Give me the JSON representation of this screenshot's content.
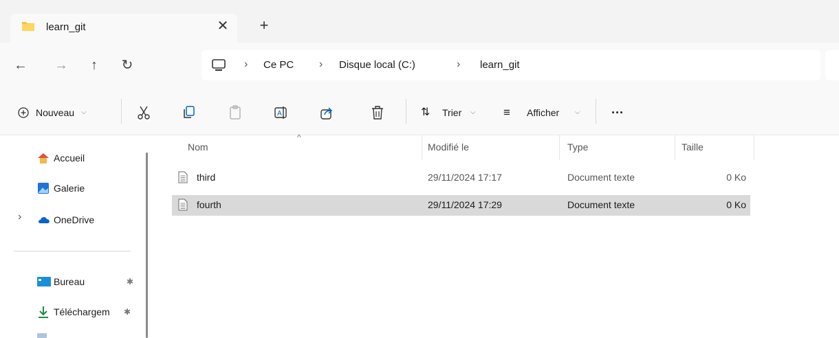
{
  "tab": {
    "title": "learn_git",
    "close_glyph": "✕",
    "new_tab_glyph": "+"
  },
  "nav": {
    "back": "←",
    "forward": "→",
    "up": "↑",
    "refresh": "↻"
  },
  "breadcrumb": {
    "items": [
      "Ce PC",
      "Disque local (C:)",
      "learn_git"
    ],
    "separator": "›"
  },
  "toolbar": {
    "new_label": "Nouveau",
    "sort_label": "Trier",
    "view_label": "Afficher",
    "more_label": "···"
  },
  "sidebar": {
    "items": [
      {
        "label": "Accueil",
        "icon": "home-icon"
      },
      {
        "label": "Galerie",
        "icon": "gallery-icon"
      },
      {
        "label": "OneDrive",
        "icon": "cloud-icon"
      },
      {
        "label": "Bureau",
        "icon": "desktop-icon",
        "pinned": true
      },
      {
        "label": "Téléchargem",
        "icon": "download-icon",
        "pinned": true
      }
    ],
    "expand_glyph": "›",
    "pin_glyph": "📌"
  },
  "columns": {
    "name": "Nom",
    "modified": "Modifié le",
    "type": "Type",
    "size": "Taille",
    "sort_glyph": "^"
  },
  "files": [
    {
      "name": "third",
      "modified": "29/11/2024 17:17",
      "type": "Document texte",
      "size": "0 Ko",
      "selected": false
    },
    {
      "name": "fourth",
      "modified": "29/11/2024 17:29",
      "type": "Document texte",
      "size": "0 Ko",
      "selected": true
    }
  ],
  "colors": {
    "folder": "#f4c542",
    "accent": "#0067c0",
    "selected_row": "#d9d9d9"
  }
}
